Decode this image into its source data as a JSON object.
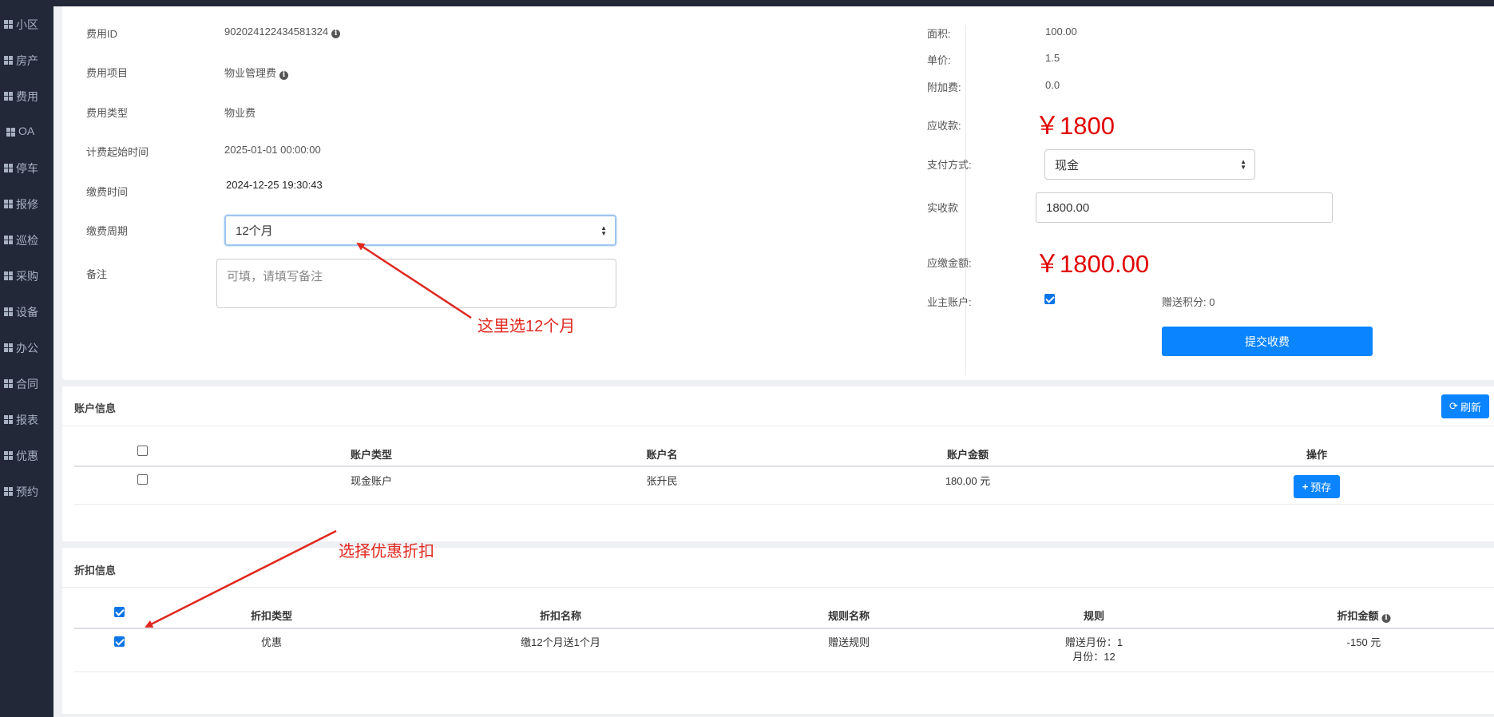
{
  "sidebar": {
    "items": [
      {
        "label": "小区"
      },
      {
        "label": "房产"
      },
      {
        "label": "费用"
      },
      {
        "label": "OA"
      },
      {
        "label": "停车"
      },
      {
        "label": "报修"
      },
      {
        "label": "巡检"
      },
      {
        "label": "采购"
      },
      {
        "label": "设备"
      },
      {
        "label": "办公"
      },
      {
        "label": "合同"
      },
      {
        "label": "报表"
      },
      {
        "label": "优惠"
      },
      {
        "label": "预约"
      }
    ]
  },
  "fee": {
    "id_label": "费用ID",
    "id_value": "902024122434581324",
    "item_label": "费用项目",
    "item_value": "物业管理费",
    "type_label": "费用类型",
    "type_value": "物业费",
    "start_label": "计费起始时间",
    "start_value": "2025-01-01 00:00:00",
    "paytime_label": "缴费时间",
    "paytime_value": "2024-12-25 19:30:43",
    "cycle_label": "缴费周期",
    "cycle_value": "12个月",
    "remark_label": "备注",
    "remark_placeholder": "可填，请填写备注"
  },
  "summary": {
    "area_label": "面积:",
    "area_value": "100.00",
    "price_label": "单价:",
    "price_value": "1.5",
    "extra_label": "附加费:",
    "extra_value": "0.0",
    "receivable_label": "应收款:",
    "receivable_value": "￥1800",
    "paymethod_label": "支付方式:",
    "paymethod_value": "现金",
    "received_label": "实收款",
    "received_value": "1800.00",
    "due_label": "应缴金额:",
    "due_value": "￥1800.00",
    "owner_account_label": "业主账户:",
    "owner_account_checked": true,
    "points_label": "赠送积分:",
    "points_value": "0",
    "submit_label": "提交收费"
  },
  "account": {
    "title": "账户信息",
    "refresh_label": "刷新",
    "columns": [
      "账户类型",
      "账户名",
      "账户金额",
      "操作"
    ],
    "rows": [
      {
        "type": "现金账户",
        "name": "张升民",
        "amount": "180.00 元",
        "action": "预存"
      }
    ]
  },
  "discount": {
    "title": "折扣信息",
    "columns": [
      "折扣类型",
      "折扣名称",
      "规则名称",
      "规则",
      "折扣金额"
    ],
    "rows": [
      {
        "type": "优惠",
        "name": "缴12个月送1个月",
        "rule_name": "赠送规则",
        "rule_line1": "赠送月份：1",
        "rule_line2": "月份：12",
        "amount": "-150 元",
        "checked": true
      }
    ]
  },
  "annotations": {
    "cycle_note": "这里选12个月",
    "discount_note": "选择优惠折扣"
  },
  "colors": {
    "sidebar_bg": "#222838",
    "primary": "#0a84ff",
    "amount_red": "#e20000",
    "annotation_red": "#e0281f"
  }
}
